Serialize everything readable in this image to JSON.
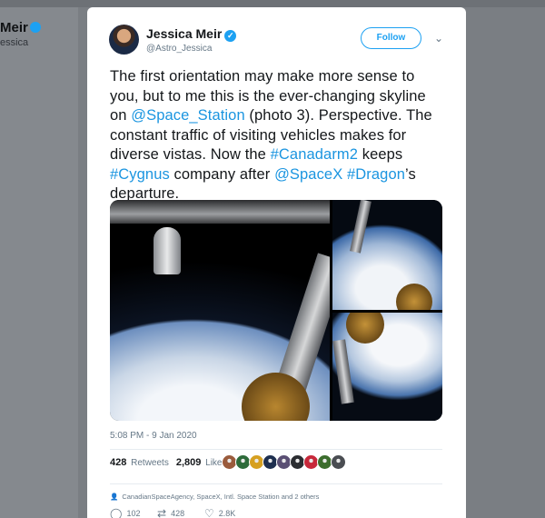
{
  "background": {
    "author_name": "Meir",
    "author_handle": "essica"
  },
  "tweet": {
    "author": {
      "name": "Jessica Meir",
      "handle": "@Astro_Jessica",
      "verified": true
    },
    "follow_label": "Follow",
    "text": {
      "t1": "The first orientation may make more sense to you, but to me this is the ever-changing skyline on ",
      "l1": "@Space_Station",
      "t2": " (photo 3). Perspective. The constant traffic of visiting vehicles makes for diverse vistas. Now the ",
      "l2": "#Canadarm2",
      "t3": " keeps ",
      "l3": "#Cygnus",
      "t4": " company after ",
      "l4": "@SpaceX",
      "t5": " ",
      "l5": "#Dragon",
      "t6": "’s departure."
    },
    "timestamp": "5:08 PM - 9 Jan 2020",
    "retweets_count": "428",
    "retweets_label": "Retweets",
    "likes_count": "2,809",
    "likes_label": "Likes",
    "liker_colors": [
      "#9a5b3c",
      "#2e6b3a",
      "#d6a021",
      "#1e2f4f",
      "#5a4f73",
      "#2b2d31",
      "#c7283a",
      "#3c6d2d",
      "#4a4d52"
    ],
    "tagged_context": "CanadianSpaceAgency, SpaceX, Intl. Space Station and 2 others",
    "actions": {
      "reply_count": "102",
      "retweet_count": "428",
      "like_count": "2.8K"
    }
  },
  "icons": {
    "verified": "check-badge-icon",
    "caret": "chevron-down-icon",
    "tag": "person-icon",
    "reply": "speech-bubble-icon",
    "retweet": "retweet-arrows-icon",
    "like": "heart-icon"
  },
  "colors": {
    "link": "#1b95e0",
    "accent": "#1da1f2",
    "muted": "#657786"
  }
}
